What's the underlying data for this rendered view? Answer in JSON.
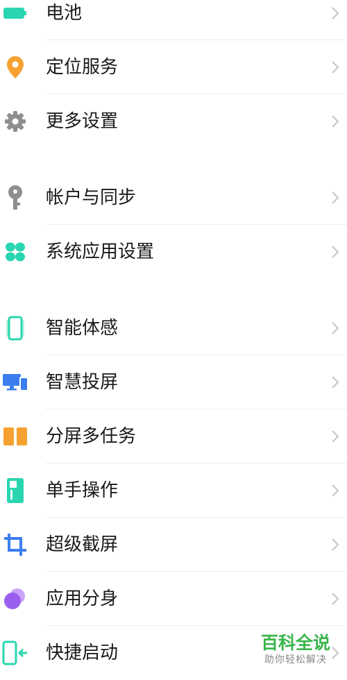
{
  "settings": {
    "items": [
      {
        "label": "电池",
        "icon": "battery-icon"
      },
      {
        "label": "定位服务",
        "icon": "location-pin-icon"
      },
      {
        "label": "更多设置",
        "icon": "gear-icon"
      },
      {
        "label": "帐户与同步",
        "icon": "key-icon"
      },
      {
        "label": "系统应用设置",
        "icon": "app-grid-icon"
      },
      {
        "label": "智能体感",
        "icon": "phone-motion-icon"
      },
      {
        "label": "智慧投屏",
        "icon": "screen-cast-icon"
      },
      {
        "label": "分屏多任务",
        "icon": "split-screen-icon"
      },
      {
        "label": "单手操作",
        "icon": "one-hand-icon"
      },
      {
        "label": "超级截屏",
        "icon": "crop-icon"
      },
      {
        "label": "应用分身",
        "icon": "app-clone-icon"
      },
      {
        "label": "快捷启动",
        "icon": "quick-launch-icon"
      }
    ]
  },
  "watermark": {
    "title": "百科全说",
    "subtitle": "助你轻松解决"
  },
  "colors": {
    "teal": "#2ad6b0",
    "orange": "#f6a233",
    "gray": "#8e8e8e",
    "blue": "#3c7ef0",
    "purple": "#9b5ff0",
    "chevron": "#c4c4c4"
  }
}
